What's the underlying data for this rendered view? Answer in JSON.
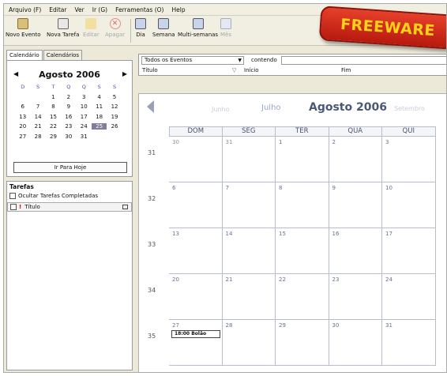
{
  "menu": [
    "Arquivo (F)",
    "Editar",
    "Ver",
    "Ir (G)",
    "Ferramentas (O)",
    "Help"
  ],
  "toolbar": {
    "new_event": "Novo Evento",
    "new_task": "Nova Tarefa",
    "edit": "Editar",
    "delete": "Apagar",
    "day": "Dia",
    "week": "Semana",
    "multiweek": "Multi-semanas",
    "month": "Mês"
  },
  "badge": "FREEWARE",
  "left_tabs": [
    "Calendário",
    "Calendários"
  ],
  "mini_calendar": {
    "title": "Agosto 2006",
    "weekdays": [
      "D",
      "S",
      "T",
      "Q",
      "Q",
      "S",
      "S"
    ],
    "rows": [
      [
        "",
        "",
        "1",
        "2",
        "3",
        "4",
        "5"
      ],
      [
        "6",
        "7",
        "8",
        "9",
        "10",
        "11",
        "12"
      ],
      [
        "13",
        "14",
        "15",
        "16",
        "17",
        "18",
        "19"
      ],
      [
        "20",
        "21",
        "22",
        "23",
        "24",
        "25",
        "26"
      ],
      [
        "27",
        "28",
        "29",
        "30",
        "31",
        "",
        ""
      ]
    ],
    "selected_day": "25",
    "goto_today": "Ir Para Hoje"
  },
  "tasks": {
    "title": "Tarefas",
    "hide_completed": "Ocultar Tarefas Completadas",
    "col_title": "Título"
  },
  "filter": {
    "selected": "Todos os Eventos",
    "contains_label": "contendo",
    "columns": [
      "Título",
      "Início",
      "Fim"
    ]
  },
  "month_nav": {
    "prev2": "Junho",
    "prev": "Julho",
    "current": "Agosto 2006",
    "next": "Setembro"
  },
  "calendar": {
    "day_headers": [
      "DOM",
      "SEG",
      "TER",
      "QUA",
      "QUI"
    ],
    "weeks": [
      {
        "num": "31",
        "days": [
          "30",
          "31",
          "1",
          "2",
          "3"
        ]
      },
      {
        "num": "32",
        "days": [
          "6",
          "7",
          "8",
          "9",
          "10"
        ]
      },
      {
        "num": "33",
        "days": [
          "13",
          "14",
          "15",
          "16",
          "17"
        ]
      },
      {
        "num": "34",
        "days": [
          "20",
          "21",
          "22",
          "23",
          "24"
        ]
      },
      {
        "num": "35",
        "days": [
          "27",
          "28",
          "29",
          "30",
          "31"
        ]
      }
    ],
    "event": {
      "text": "18:00 Bolão"
    }
  }
}
